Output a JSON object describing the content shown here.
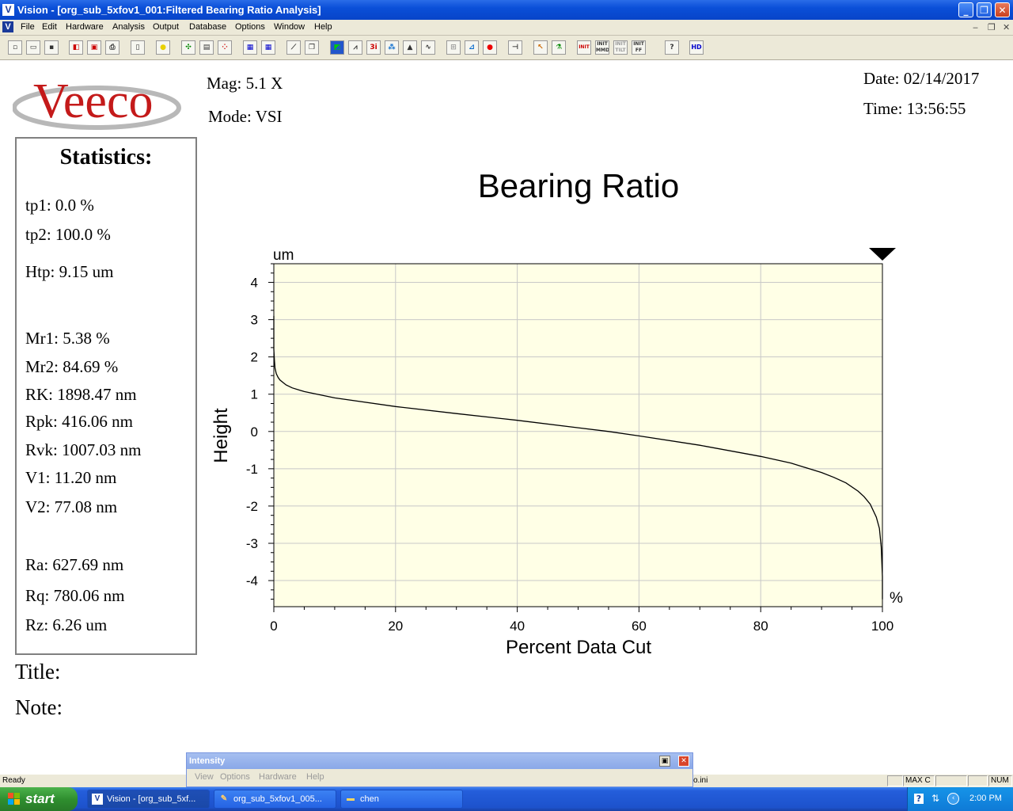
{
  "window": {
    "title": "Vision - [org_sub_5xfov1_001:Filtered Bearing Ratio Analysis]",
    "app_icon_letter": "V"
  },
  "menu": [
    "File",
    "Edit",
    "Hardware",
    "Analysis",
    "Output",
    "Database",
    "Options",
    "Window",
    "Help"
  ],
  "toolbar_icons": [
    "new-icon",
    "open-icon",
    "save-icon",
    "export-icon",
    "save-as-icon",
    "print-icon",
    "page-icon",
    "light-icon",
    "stitch-icon",
    "database-icon",
    "colormap-icon",
    "report-icon",
    "report2-icon",
    "measure-icon",
    "copy-icon",
    "3d-contour-icon",
    "profile-icon",
    "3d-interactive-icon",
    "histogram-icon",
    "peaks-icon",
    "bearing-ratio-icon",
    "mask-icon",
    "data-icon",
    "record-icon",
    "focus-icon",
    "cursor-icon",
    "flask-icon",
    "init-icon",
    "init-mmd-icon",
    "init-tilt-icon",
    "init-ff-icon",
    "help-icon",
    "hd-icon"
  ],
  "toolbar_text": {
    "init": "INIT",
    "init_mmd": "INIT MMD",
    "init_tilt": "INIT TILT",
    "init_ff": "INIT FF",
    "hd": "HD",
    "help": "?",
    "three_i": "3i"
  },
  "logo": {
    "text": "Veeco"
  },
  "header": {
    "mag_label": "Mag:",
    "mag_value": "5.1 X",
    "mode_label": "Mode:",
    "mode_value": "VSI",
    "date_label": "Date:",
    "date_value": "02/14/2017",
    "time_label": "Time:",
    "time_value": "13:56:55"
  },
  "stats": {
    "heading": "Statistics:",
    "lines": [
      "tp1: 0.0 %",
      "tp2: 100.0 %",
      "Htp: 9.15 um",
      "Mr1: 5.38 %",
      "Mr2: 84.69 %",
      "RK: 1898.47 nm",
      "Rpk: 416.06 nm",
      "Rvk: 1007.03 nm",
      "V1: 11.20 nm",
      "V2: 77.08 nm",
      "Ra: 627.69 nm",
      "Rq: 780.06 nm",
      "Rz: 6.26 um"
    ]
  },
  "title_label": "Title:",
  "note_label": "Note:",
  "chart_data": {
    "type": "line",
    "title": "Bearing Ratio",
    "xlabel": "Percent Data Cut",
    "ylabel": "Height",
    "x_unit": "%",
    "y_unit": "um",
    "xlim": [
      0,
      100
    ],
    "ylim": [
      -4.7,
      4.5
    ],
    "xticks": [
      0,
      20,
      40,
      60,
      80,
      100
    ],
    "yticks": [
      4,
      3,
      2,
      1,
      0,
      -1,
      -2,
      -3,
      -4
    ],
    "grid": true,
    "background": "#ffffe6",
    "series": [
      {
        "color": "#000000",
        "x": [
          0,
          0,
          0.1,
          0.2,
          0.4,
          0.7,
          1,
          2,
          3,
          5,
          10,
          20,
          30,
          40,
          50,
          55,
          60,
          70,
          80,
          85,
          90,
          92,
          94,
          96,
          97,
          98,
          99,
          99.5,
          99.8,
          100,
          100
        ],
        "y": [
          3.1,
          2.2,
          1.9,
          1.7,
          1.55,
          1.45,
          1.38,
          1.25,
          1.17,
          1.07,
          0.9,
          0.67,
          0.48,
          0.3,
          0.1,
          0.0,
          -0.12,
          -0.37,
          -0.67,
          -0.85,
          -1.1,
          -1.23,
          -1.38,
          -1.6,
          -1.75,
          -1.95,
          -2.3,
          -2.6,
          -3.1,
          -3.9,
          -4.5
        ]
      }
    ],
    "marker": "down-triangle at 100%"
  },
  "status": {
    "text": "Ready",
    "ini": "o.ini",
    "maxc": "MAX C",
    "num": "NUM"
  },
  "intensity_panel": {
    "title": "Intensity",
    "menu": [
      "View",
      "Options",
      "Hardware",
      "Help"
    ]
  },
  "taskbar": {
    "start": "start",
    "tasks": [
      "Vision - [org_sub_5xf...",
      "org_sub_5xfov1_005...",
      "chen"
    ],
    "clock": "2:00 PM"
  },
  "colors": {
    "accent": "#0a4fd8",
    "logo_red": "#c41a1a",
    "plot_bg": "#ffffe6"
  }
}
